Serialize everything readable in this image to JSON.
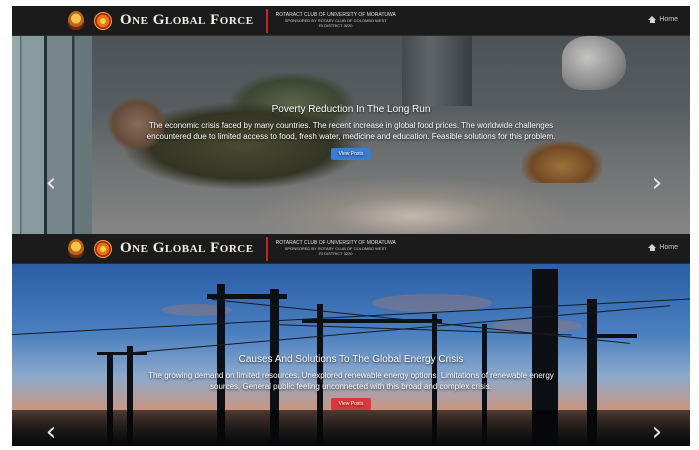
{
  "header": {
    "brand": "One Global Force",
    "club_line1": "Rotaract Club of University Of Moratuwa",
    "club_line2": "Sponsored by Rotary Club Of Colombo West",
    "club_line3": "RI District 3220",
    "home_label": "Home"
  },
  "slides": [
    {
      "title": "Poverty Reduction In The Long Run",
      "text": "The economic crisis faced by many countries. The recent increase in global food prices. The worldwide challenges encountered due to limited access to food, fresh water, medicine and education. Feasible solutions for this problem.",
      "button": "View Posts",
      "button_color": "#3a7ccf"
    },
    {
      "title": "Causes And Solutions To The Global Energy Crisis",
      "text": "The growing demand on limited resources. Unexplored renewable energy options. Limitations of renewable energy sources. General public feeling unconnected with this broad and complex crisis.",
      "button": "View Posts",
      "button_color": "#d9383a"
    }
  ],
  "controls": {
    "prev": "‹",
    "next": "›"
  },
  "icons": [
    "emblem-icon",
    "logo-icon",
    "home-icon",
    "chevron-left-icon",
    "chevron-right-icon"
  ]
}
